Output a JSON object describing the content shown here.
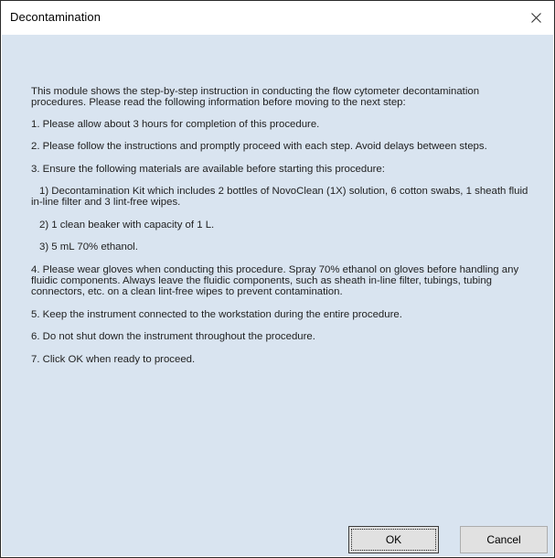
{
  "window": {
    "title": "Decontamination"
  },
  "content": {
    "intro": "This module shows the step-by-step instruction in conducting the flow cytometer decontamination procedures. Please read the following information before moving to the next step:",
    "step1": "1. Please allow about 3 hours for completion of this procedure.",
    "step2": "2. Please follow the instructions and promptly proceed with each step. Avoid delays between steps.",
    "step3": "3. Ensure the following materials are available before starting this procedure:",
    "step3_items": [
      "1) Decontamination Kit which includes 2 bottles of NovoClean (1X) solution, 6 cotton swabs, 1 sheath fluid in-line filter and 3 lint-free wipes.",
      "2) 1 clean beaker with capacity of 1 L.",
      "3) 5 mL 70% ethanol."
    ],
    "step4": "4. Please wear gloves when conducting this procedure. Spray 70% ethanol on gloves before handling any fluidic components. Always leave the fluidic components, such as sheath in-line filter, tubings, tubing connectors, etc. on a clean lint-free wipes to prevent contamination.",
    "step5": "5. Keep the instrument connected to the workstation during the entire procedure.",
    "step6": "6. Do not shut down the instrument throughout the procedure.",
    "step7": "7. Click OK when ready to proceed."
  },
  "buttons": {
    "ok_label": "OK",
    "cancel_label": "Cancel"
  },
  "icons": {
    "close": "close-icon"
  },
  "colors": {
    "client_background": "#d9e4f0",
    "button_background": "#e1e1e1",
    "text": "#1f1f1f"
  }
}
